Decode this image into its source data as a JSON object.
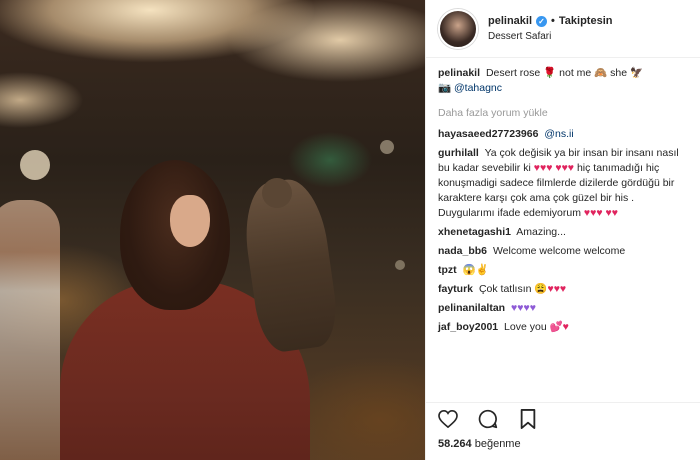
{
  "header": {
    "username": "pelinakil",
    "separator": "•",
    "follow_label": "Takiptesin",
    "location": "Dessert Safari"
  },
  "caption": {
    "username": "pelinakil",
    "text_1": "Desert rose",
    "text_2": "not me",
    "text_3": "she",
    "photo_credit": "@tahagnc"
  },
  "load_more_label": "Daha fazla yorum yükle",
  "comments": [
    {
      "username": "hayasaeed27723966",
      "text": "@ns.ii"
    },
    {
      "username": "gurhilall",
      "text": "Ya çok değisik ya bir insan bir insanı nasıl bu kadar sevebilir ki",
      "text_2": "hiç tanımadığı hiç konuşmadigi sadece filmlerde dizilerde gördüğü bir karaktere karşı çok ama çok güzel bir his . Duygularımı ifade edemiyorum"
    },
    {
      "username": "xhenetagashi1",
      "text": "Amazing..."
    },
    {
      "username": "nada_bb6",
      "text": "Welcome welcome welcome"
    },
    {
      "username": "tpzt",
      "text": ""
    },
    {
      "username": "fayturk",
      "text": "Çok tatlısın"
    },
    {
      "username": "pelinanilaltan",
      "text": ""
    },
    {
      "username": "jaf_boy2001",
      "text": "Love you"
    }
  ],
  "likes": {
    "count": "58.264",
    "label": "beğenme"
  },
  "icons": [
    "verified-icon",
    "heart-icon",
    "comment-icon",
    "bookmark-icon"
  ],
  "colors": {
    "link": "#003569",
    "verified": "#3897f0",
    "muted": "#999999",
    "heart": "#e0245e"
  }
}
